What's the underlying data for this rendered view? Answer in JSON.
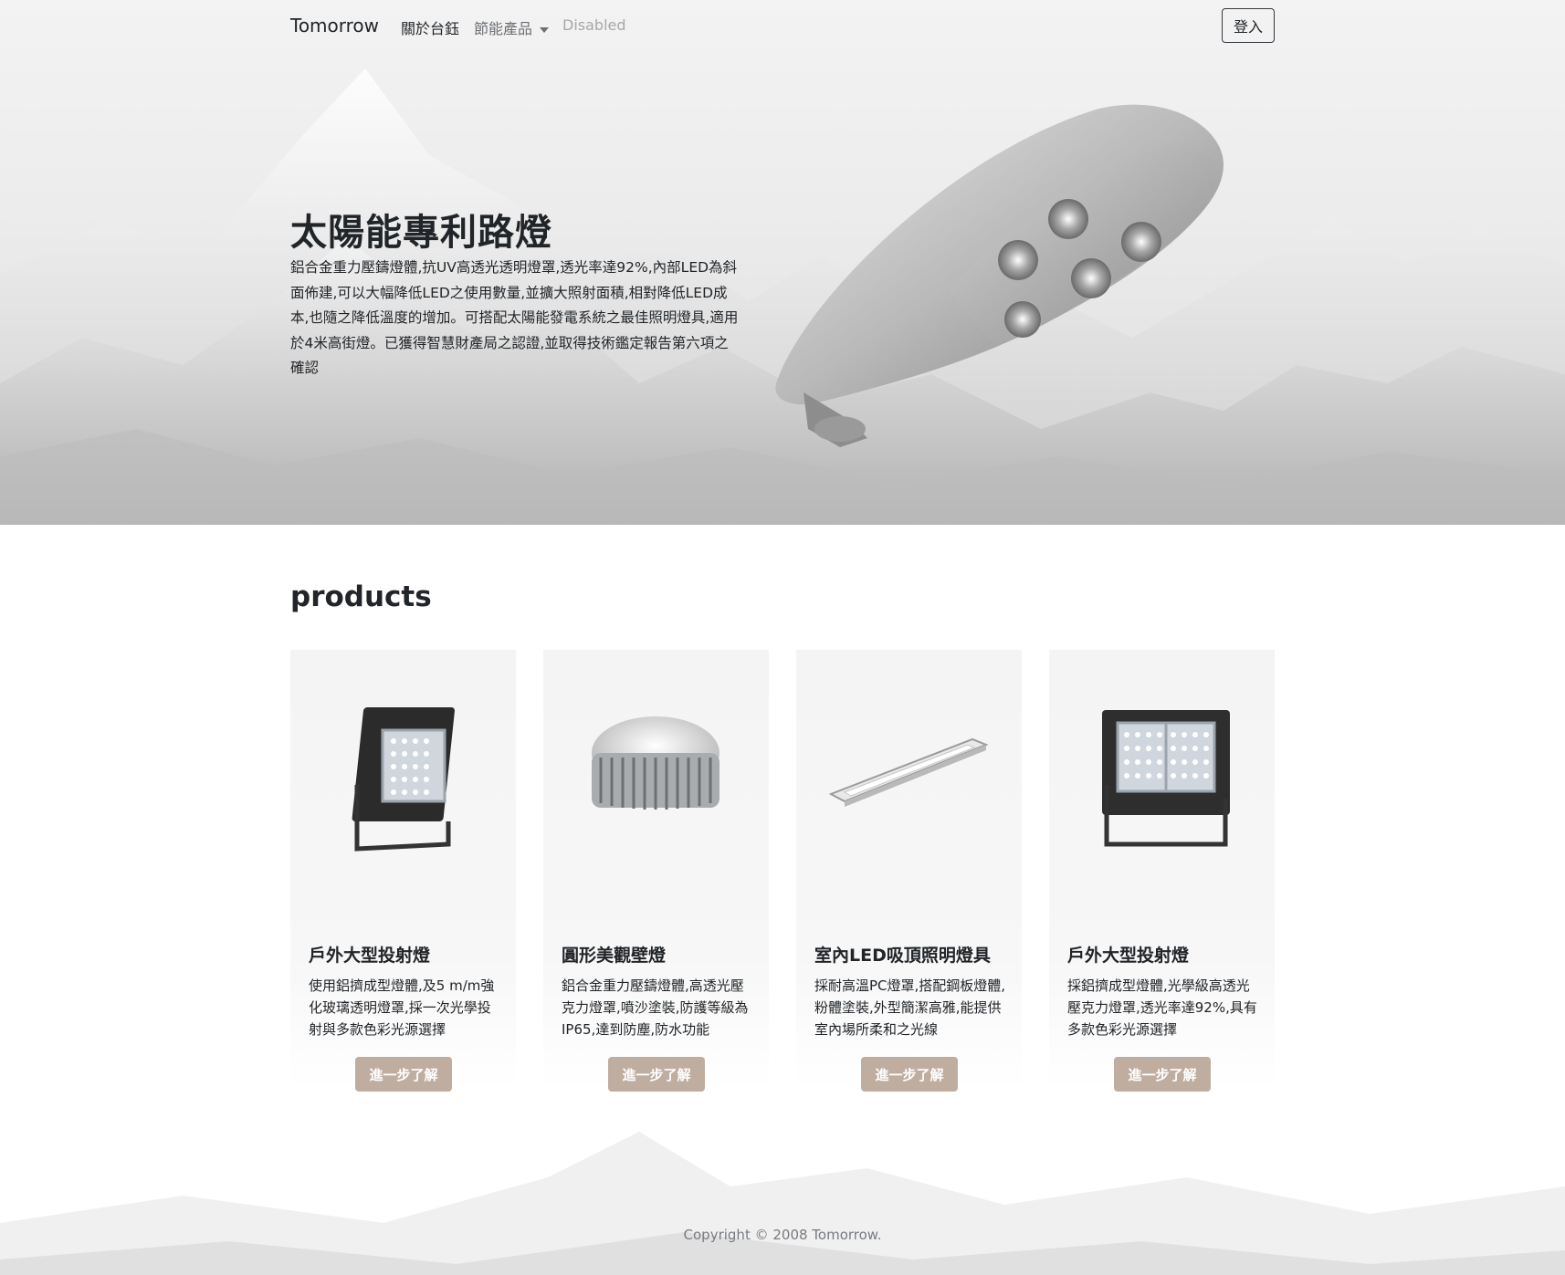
{
  "navbar": {
    "brand": "Tomorrow",
    "links": [
      {
        "label": "關於台鈺"
      },
      {
        "label": "節能產品"
      },
      {
        "label": "Disabled"
      }
    ],
    "login_label": "登入"
  },
  "hero": {
    "title": "太陽能專利路燈",
    "description": "鋁合金重力壓鑄燈體,抗UV高透光透明燈罩,透光率達92%,內部LED為斜面佈建,可以大幅降低LED之使用數量,並擴大照射面積,相對降低LED成本,也隨之降低溫度的增加。可搭配太陽能發電系統之最佳照明燈具,適用於4米高街燈。已獲得智慧財產局之認證,並取得技術鑑定報告第六項之確認"
  },
  "products": {
    "heading": "products",
    "items": [
      {
        "title": "戶外大型投射燈",
        "text": "使用鋁擠成型燈體,及5 m/m強化玻璃透明燈罩,採一次光學投射與多款色彩光源選擇",
        "button": "進一步了解",
        "image_icon": "floodlight-icon"
      },
      {
        "title": "圓形美觀壁燈",
        "text": "鋁合金重力壓鑄燈體,高透光壓克力燈罩,噴沙塗裝,防護等級為IP65,達到防塵,防水功能",
        "button": "進一步了解",
        "image_icon": "round-wall-lamp-icon"
      },
      {
        "title": "室內LED吸頂照明燈具",
        "text": "採耐高溫PC燈罩,搭配鋼板燈體,粉體塗裝,外型簡潔高雅,能提供室內場所柔和之光線",
        "button": "進一步了解",
        "image_icon": "linear-ceiling-lamp-icon"
      },
      {
        "title": "戶外大型投射燈",
        "text": "採鋁擠成型燈體,光學級高透光壓克力燈罩,透光率達92%,具有多款色彩光源選擇",
        "button": "進一步了解",
        "image_icon": "large-floodlight-icon"
      }
    ]
  },
  "footer": {
    "copyright": "Copyright © 2008 Tomorrow."
  },
  "colors": {
    "button_bg": "#bfaea0",
    "text": "#212529",
    "muted": "#6c6f73",
    "disabled": "#a5a8ab"
  }
}
